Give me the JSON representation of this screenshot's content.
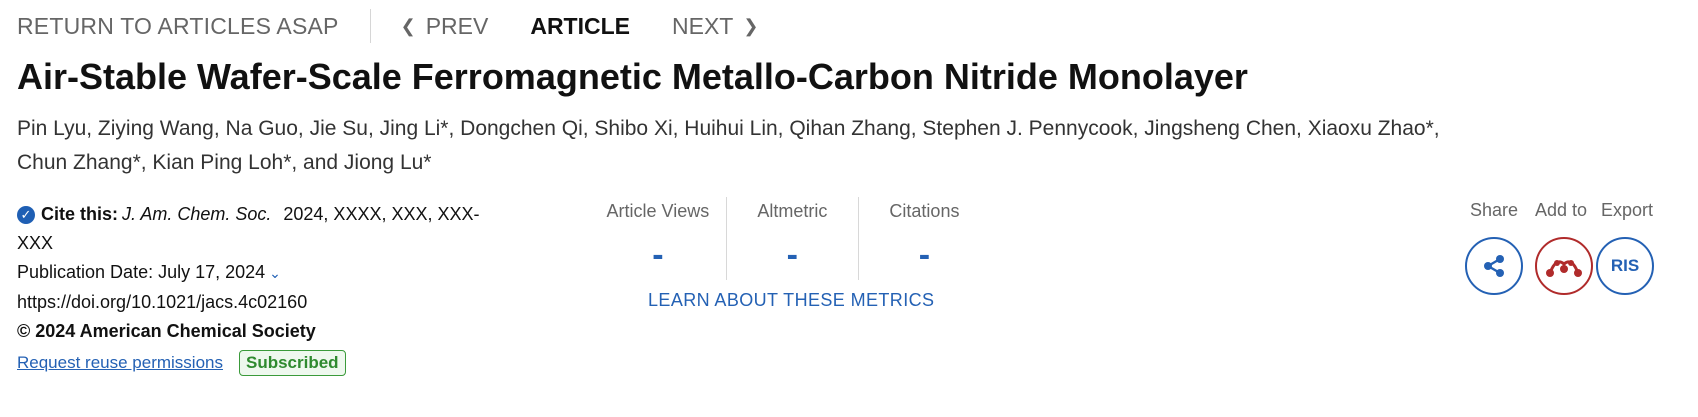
{
  "nav": {
    "return_label": "RETURN TO ARTICLES ASAP",
    "prev_label": "PREV",
    "article_label": "ARTICLE",
    "next_label": "NEXT"
  },
  "article": {
    "title": "Air-Stable Wafer-Scale Ferromagnetic Metallo-Carbon Nitride Monolayer",
    "authors_line1": "Pin Lyu, Ziying Wang, Na Guo, Jie Su, Jing Li*, Dongchen Qi, Shibo Xi, Huihui Lin, Qihan Zhang, Stephen J. Pennycook, Jingsheng Chen, Xiaoxu Zhao*,",
    "authors_line2": "Chun Zhang*, Kian Ping Loh*, and Jiong Lu*"
  },
  "cite": {
    "label": "Cite this:",
    "journal": "J. Am. Chem. Soc.",
    "citation": "2024, XXXX, XXX, XXX-",
    "citation_cont": "XXX",
    "pub_date": "Publication Date: July 17, 2024",
    "doi": "https://doi.org/10.1021/jacs.4c02160",
    "copyright": "© 2024 American Chemical Society",
    "reuse_link": "Request reuse permissions",
    "badge": "Subscribed"
  },
  "metrics": {
    "items": [
      {
        "label": "Article Views",
        "value": "-"
      },
      {
        "label": "Altmetric",
        "value": "-"
      },
      {
        "label": "Citations",
        "value": "-"
      }
    ],
    "learn_link": "LEARN ABOUT THESE METRICS"
  },
  "actions": {
    "share_label": "Share",
    "add_label": "Add to",
    "export_label": "Export",
    "ris_label": "RIS"
  },
  "icons": {
    "check": "check-circle-icon",
    "share": "share-icon",
    "mendeley": "mendeley-icon",
    "chevron_left": "chevron-left-icon",
    "chevron_right": "chevron-right-icon",
    "chevron_down": "chevron-down-icon"
  },
  "colors": {
    "link_blue": "#2461b4",
    "mendeley_red": "#b02b2b",
    "subscribed_green": "#2f8a2f"
  }
}
